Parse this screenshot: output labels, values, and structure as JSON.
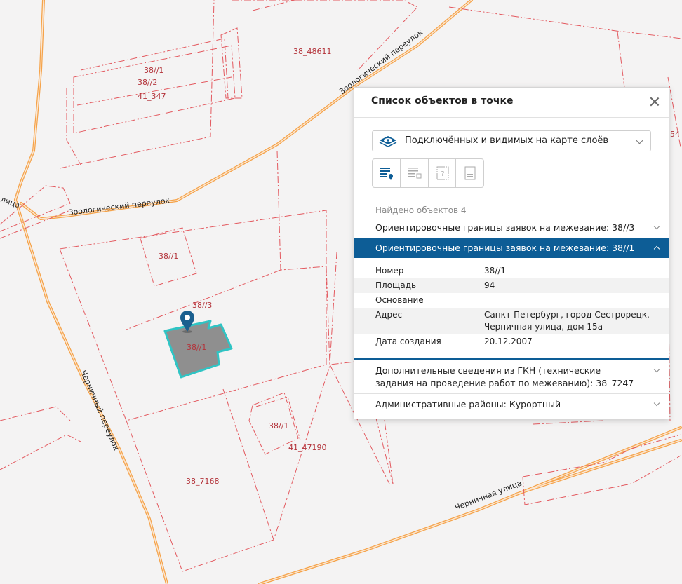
{
  "map": {
    "labels": {
      "l1": "38//1",
      "l2": "38//2",
      "l3": "41_347",
      "l4": "38_48611",
      "l5": "38//1",
      "l6": "38//3",
      "l7": "38//1",
      "l8": "38//1",
      "l9": "41_47190",
      "l10": "38_7168",
      "l11": "54"
    },
    "streets": {
      "s1": "Зоологический переулок",
      "s2": "Зоологический переулок",
      "s3": "Черничный переулок",
      "s4": "Черничная улица",
      "s5": "лица"
    },
    "colors": {
      "background": "#f4f3f3",
      "road": "#f5a34a",
      "boundary": "#e3595f",
      "selected_fill": "#8f8f8f",
      "selected_outline": "#2fc4c4",
      "marker": "#1a5f8f"
    }
  },
  "panel": {
    "title": "Список объектов в точке",
    "close_icon": "close-icon",
    "layer_filter": "Подключённых и видимых на карте слоёв",
    "found": "Найдено объектов 4",
    "items": [
      {
        "label": "Ориентировочные границы заявок на межевание: 38//3"
      },
      {
        "label": "Ориентировочные границы заявок на межевание: 38//1"
      },
      {
        "label": "Дополнительные сведения из ГКН (технические задания на проведение работ по межеванию): 38_7247"
      },
      {
        "label": "Административные районы: Курортный"
      }
    ],
    "details": [
      {
        "key": "Номер",
        "value": "38//1"
      },
      {
        "key": "Площадь",
        "value": "94"
      },
      {
        "key": "Основание",
        "value": ""
      },
      {
        "key": "Адрес",
        "value": "Санкт-Петербург, город Сестрорецк, Черничная улица, дом 15а"
      },
      {
        "key": "Дата создания",
        "value": "20.12.2007"
      }
    ],
    "accent": "#0d5d96"
  }
}
